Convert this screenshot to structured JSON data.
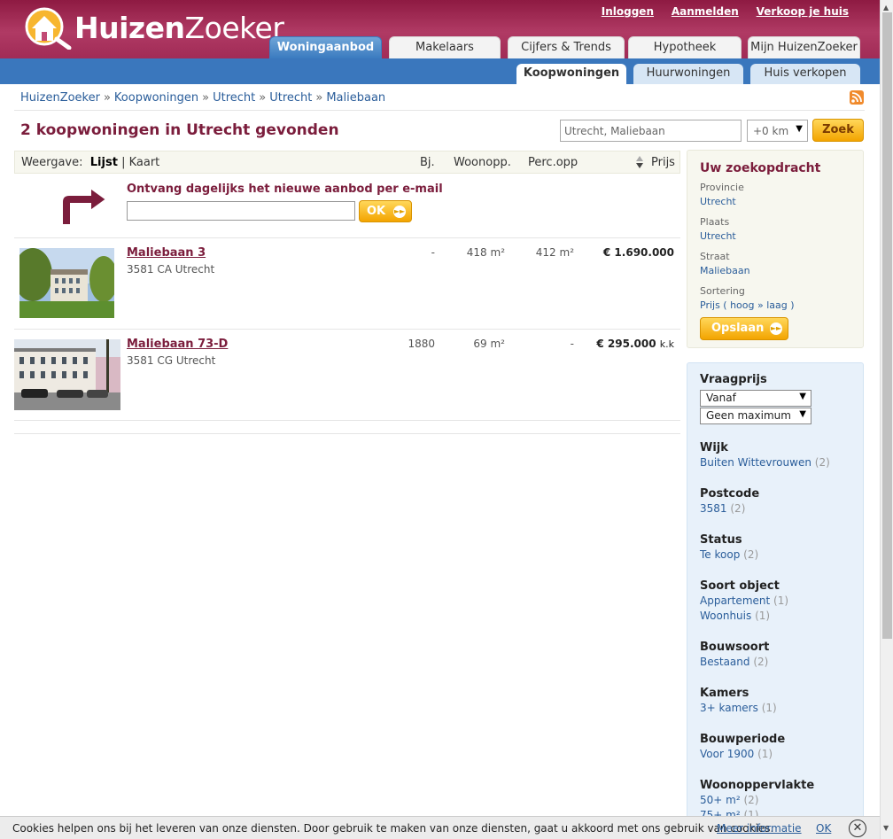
{
  "header": {
    "logo_text_bold": "Huizen",
    "logo_text_light": "Zoeker",
    "links": [
      "Inloggen",
      "Aanmelden",
      "Verkoop je huis"
    ],
    "tabs": [
      "Woningaanbod",
      "Makelaars",
      "Cijfers & Trends",
      "Hypotheek",
      "Mijn HuizenZoeker"
    ],
    "subtabs": [
      "Koopwoningen",
      "Huurwoningen",
      "Huis verkopen"
    ]
  },
  "breadcrumb": [
    "HuizenZoeker",
    "Koopwoningen",
    "Utrecht",
    "Utrecht",
    "Maliebaan"
  ],
  "result_title": "2 koopwoningen in Utrecht gevonden",
  "search": {
    "value": "Utrecht, Maliebaan",
    "radius": "+0 km",
    "button": "Zoek"
  },
  "listhead": {
    "weergave": "Weergave:",
    "lijst": "Lijst",
    "sep": "|",
    "kaart": "Kaart",
    "bj": "Bj.",
    "woonopp": "Woonopp.",
    "percopp": "Perc.opp",
    "prijs": "Prijs"
  },
  "email_signup": {
    "title": "Ontvang dagelijks het nieuwe aanbod per e-mail",
    "button": "OK"
  },
  "listings": [
    {
      "title": "Maliebaan 3",
      "address": "3581 CA Utrecht",
      "bj": "-",
      "woonopp": "418 m²",
      "percopp": "412 m²",
      "price": "€ 1.690.000",
      "price_suffix": ""
    },
    {
      "title": "Maliebaan 73-D",
      "address": "3581 CG Utrecht",
      "bj": "1880",
      "woonopp": "69 m²",
      "percopp": "-",
      "price": "€ 295.000",
      "price_suffix": "k.k"
    }
  ],
  "zoekopdracht": {
    "title": "Uw zoekopdracht",
    "fields": [
      {
        "label": "Provincie",
        "value": "Utrecht"
      },
      {
        "label": "Plaats",
        "value": "Utrecht"
      },
      {
        "label": "Straat",
        "value": "Maliebaan"
      },
      {
        "label": "Sortering",
        "value": "Prijs ( hoog » laag )"
      }
    ],
    "button": "Opslaan"
  },
  "filters": {
    "vraagprijs": {
      "title": "Vraagprijs",
      "from": "Vanaf",
      "to": "Geen maximum"
    },
    "groups": [
      {
        "title": "Wijk",
        "items": [
          {
            "label": "Buiten Wittevrouwen",
            "count": "(2)"
          }
        ]
      },
      {
        "title": "Postcode",
        "items": [
          {
            "label": "3581",
            "count": "(2)"
          }
        ]
      },
      {
        "title": "Status",
        "items": [
          {
            "label": "Te koop",
            "count": "(2)"
          }
        ]
      },
      {
        "title": "Soort object",
        "items": [
          {
            "label": "Appartement",
            "count": "(1)"
          },
          {
            "label": "Woonhuis",
            "count": "(1)"
          }
        ]
      },
      {
        "title": "Bouwsoort",
        "items": [
          {
            "label": "Bestaand",
            "count": "(2)"
          }
        ]
      },
      {
        "title": "Kamers",
        "items": [
          {
            "label": "3+ kamers",
            "count": "(1)"
          }
        ]
      },
      {
        "title": "Bouwperiode",
        "items": [
          {
            "label": "Voor 1900",
            "count": "(1)"
          }
        ]
      },
      {
        "title": "Woonoppervlakte",
        "items": [
          {
            "label": "50+ m²",
            "count": "(2)"
          },
          {
            "label": "75+ m²",
            "count": "(1)"
          }
        ]
      }
    ]
  },
  "cookie": {
    "text": "Cookies helpen ons bij het leveren van onze diensten. Door gebruik te maken van onze diensten, gaat u akkoord met ons gebruik van cookies.",
    "more": "Meer informatie",
    "ok": "OK",
    "close": "✕"
  },
  "colors": {
    "brand": "#8e1a42",
    "nav_blue": "#3a77bd",
    "link": "#2a5d9a",
    "button": "#f3a400"
  }
}
